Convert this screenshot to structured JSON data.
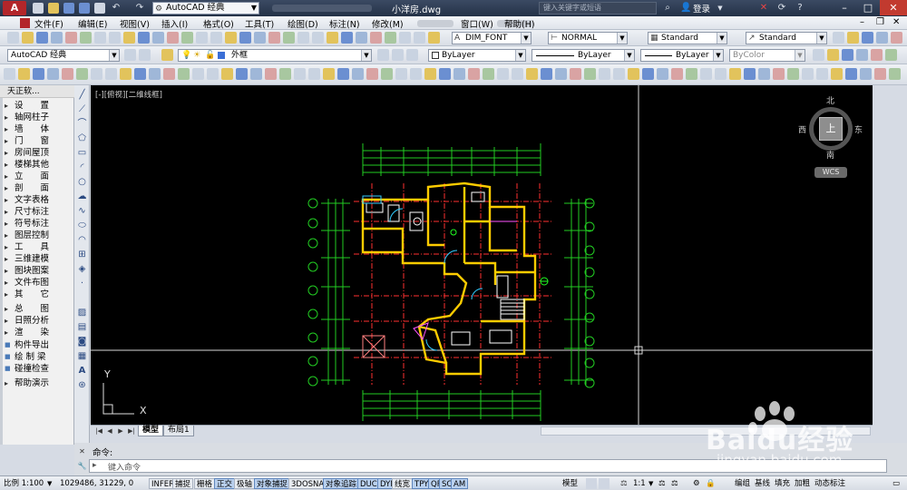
{
  "title_bar": {
    "workspace": "AutoCAD 经典",
    "document_title": "小洋房.dwg",
    "search_placeholder": "键入关键字或短语",
    "login": "登录"
  },
  "menu": [
    "文件(F)",
    "编辑(E)",
    "视图(V)",
    "插入(I)",
    "格式(O)",
    "工具(T)",
    "绘图(D)",
    "标注(N)",
    "修改(M)",
    "窗口(W)",
    "帮助(H)"
  ],
  "toolbar2": {
    "text_style": "DIM_FONT",
    "dim_style": "NORMAL",
    "table_style": "Standard",
    "mleader_style": "Standard"
  },
  "toolbar3": {
    "workspace": "AutoCAD 经典",
    "layer": "外框",
    "color": "ByLayer",
    "linetype": "ByLayer",
    "lineweight": "ByLayer",
    "plotstyle": "ByColor"
  },
  "palette": {
    "header": "天正软...",
    "items": [
      "设　　置",
      "轴网柱子",
      "墙　　体",
      "门　　窗",
      "房间屋顶",
      "楼梯其他",
      "立　　面",
      "剖　　面",
      "文字表格",
      "尺寸标注",
      "符号标注",
      "图层控制",
      "工　　具",
      "三维建模",
      "图块图案",
      "文件布图",
      "其　　它",
      "总　　图",
      "日照分析",
      "渲　　染",
      "构件导出",
      "绘 制 梁",
      "碰撞检查",
      "帮助演示"
    ]
  },
  "canvas": {
    "viewport_label": "[-][俯视][二维线框]",
    "ucs_y": "Y",
    "ucs_x": "X",
    "viewcube": {
      "north": "北",
      "south": "南",
      "east": "东",
      "west": "西",
      "top": "上",
      "wcs": "WCS"
    }
  },
  "tabs": [
    "模型",
    "布局1"
  ],
  "command": {
    "history": "命令:",
    "prompt": "键入命令"
  },
  "status": {
    "scale": "比例 1:100",
    "coords": "1029486, 31229, 0",
    "toggles": [
      "INFER",
      "捕捉",
      "栅格",
      "正交",
      "极轴",
      "对象捕捉",
      "3DOSNAP",
      "对象追踪",
      "DUCS",
      "DYN",
      "线宽",
      "TPY",
      "QP",
      "SC",
      "AM"
    ],
    "toggles_on": [
      "正交",
      "对象捕捉",
      "对象追踪",
      "DUCS",
      "DYN",
      "TPY",
      "QP",
      "SC",
      "AM"
    ],
    "model": "模型",
    "annoscale": "1:1",
    "right_items": [
      "编组",
      "基线",
      "填充",
      "加粗",
      "动态标注"
    ]
  },
  "watermark": {
    "brand": "Baidu经验",
    "url": "jingyan.baidu.com"
  },
  "colors": {
    "canvas_bg": "#000000",
    "wall": "#ffcc00",
    "dim": "#00ff00",
    "axis": "#ff3030",
    "crosshair": "#ffffff"
  }
}
